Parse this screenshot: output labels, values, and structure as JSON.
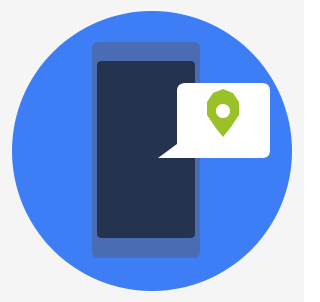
{
  "illustration": {
    "background_color": "#f5f5f5",
    "circle_color": "#3d7df5",
    "phone_body_color": "#4a6cb3",
    "phone_screen_color": "#26334f",
    "bubble_color": "#ffffff",
    "pin_color": "#9ac12a",
    "pin_center_color": "#ffffff",
    "icons": [
      "smartphone-icon",
      "speech-bubble-icon",
      "location-pin-icon"
    ]
  }
}
